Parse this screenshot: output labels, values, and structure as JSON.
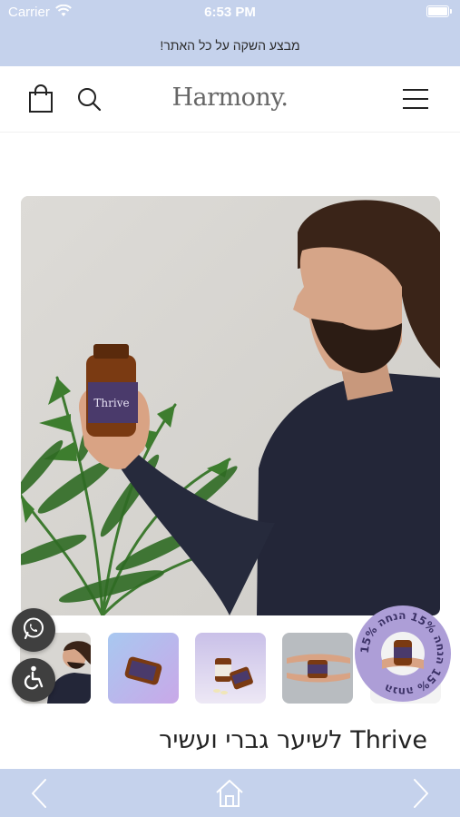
{
  "status_bar": {
    "carrier": "Carrier",
    "time": "6:53 PM",
    "icons": [
      "wifi-icon",
      "battery-icon"
    ]
  },
  "promo": {
    "text": "מבצע השקה על כל האתר!"
  },
  "header": {
    "logo": "Harmony.",
    "icons": [
      "shopping-bag-icon",
      "search-icon",
      "hamburger-menu-icon"
    ]
  },
  "product": {
    "title": "Thrive לשיער גברי ועשיר",
    "hero_bottle_label": "Thrive",
    "thumbnails": [
      "thumb-man-with-bottle",
      "thumb-bottle-on-gradient",
      "thumb-bottles-with-capsules",
      "thumb-hands-with-bottle",
      "thumb-hand-with-bottle"
    ],
    "selected_thumbnail": "thumb-man-with-bottle"
  },
  "badge": {
    "text": "15% הנחה 15% הנחה 15% הנחה "
  },
  "floating": {
    "icons": [
      "whatsapp-icon",
      "accessibility-icon"
    ]
  },
  "bottom_nav": {
    "icons": [
      "chevron-left-icon",
      "home-icon",
      "chevron-right-icon"
    ]
  },
  "colors": {
    "bars": "#c5d2ec",
    "badge": "#ad9ed7",
    "bottle_label": "#4a3a6b",
    "sweater": "#232638"
  }
}
